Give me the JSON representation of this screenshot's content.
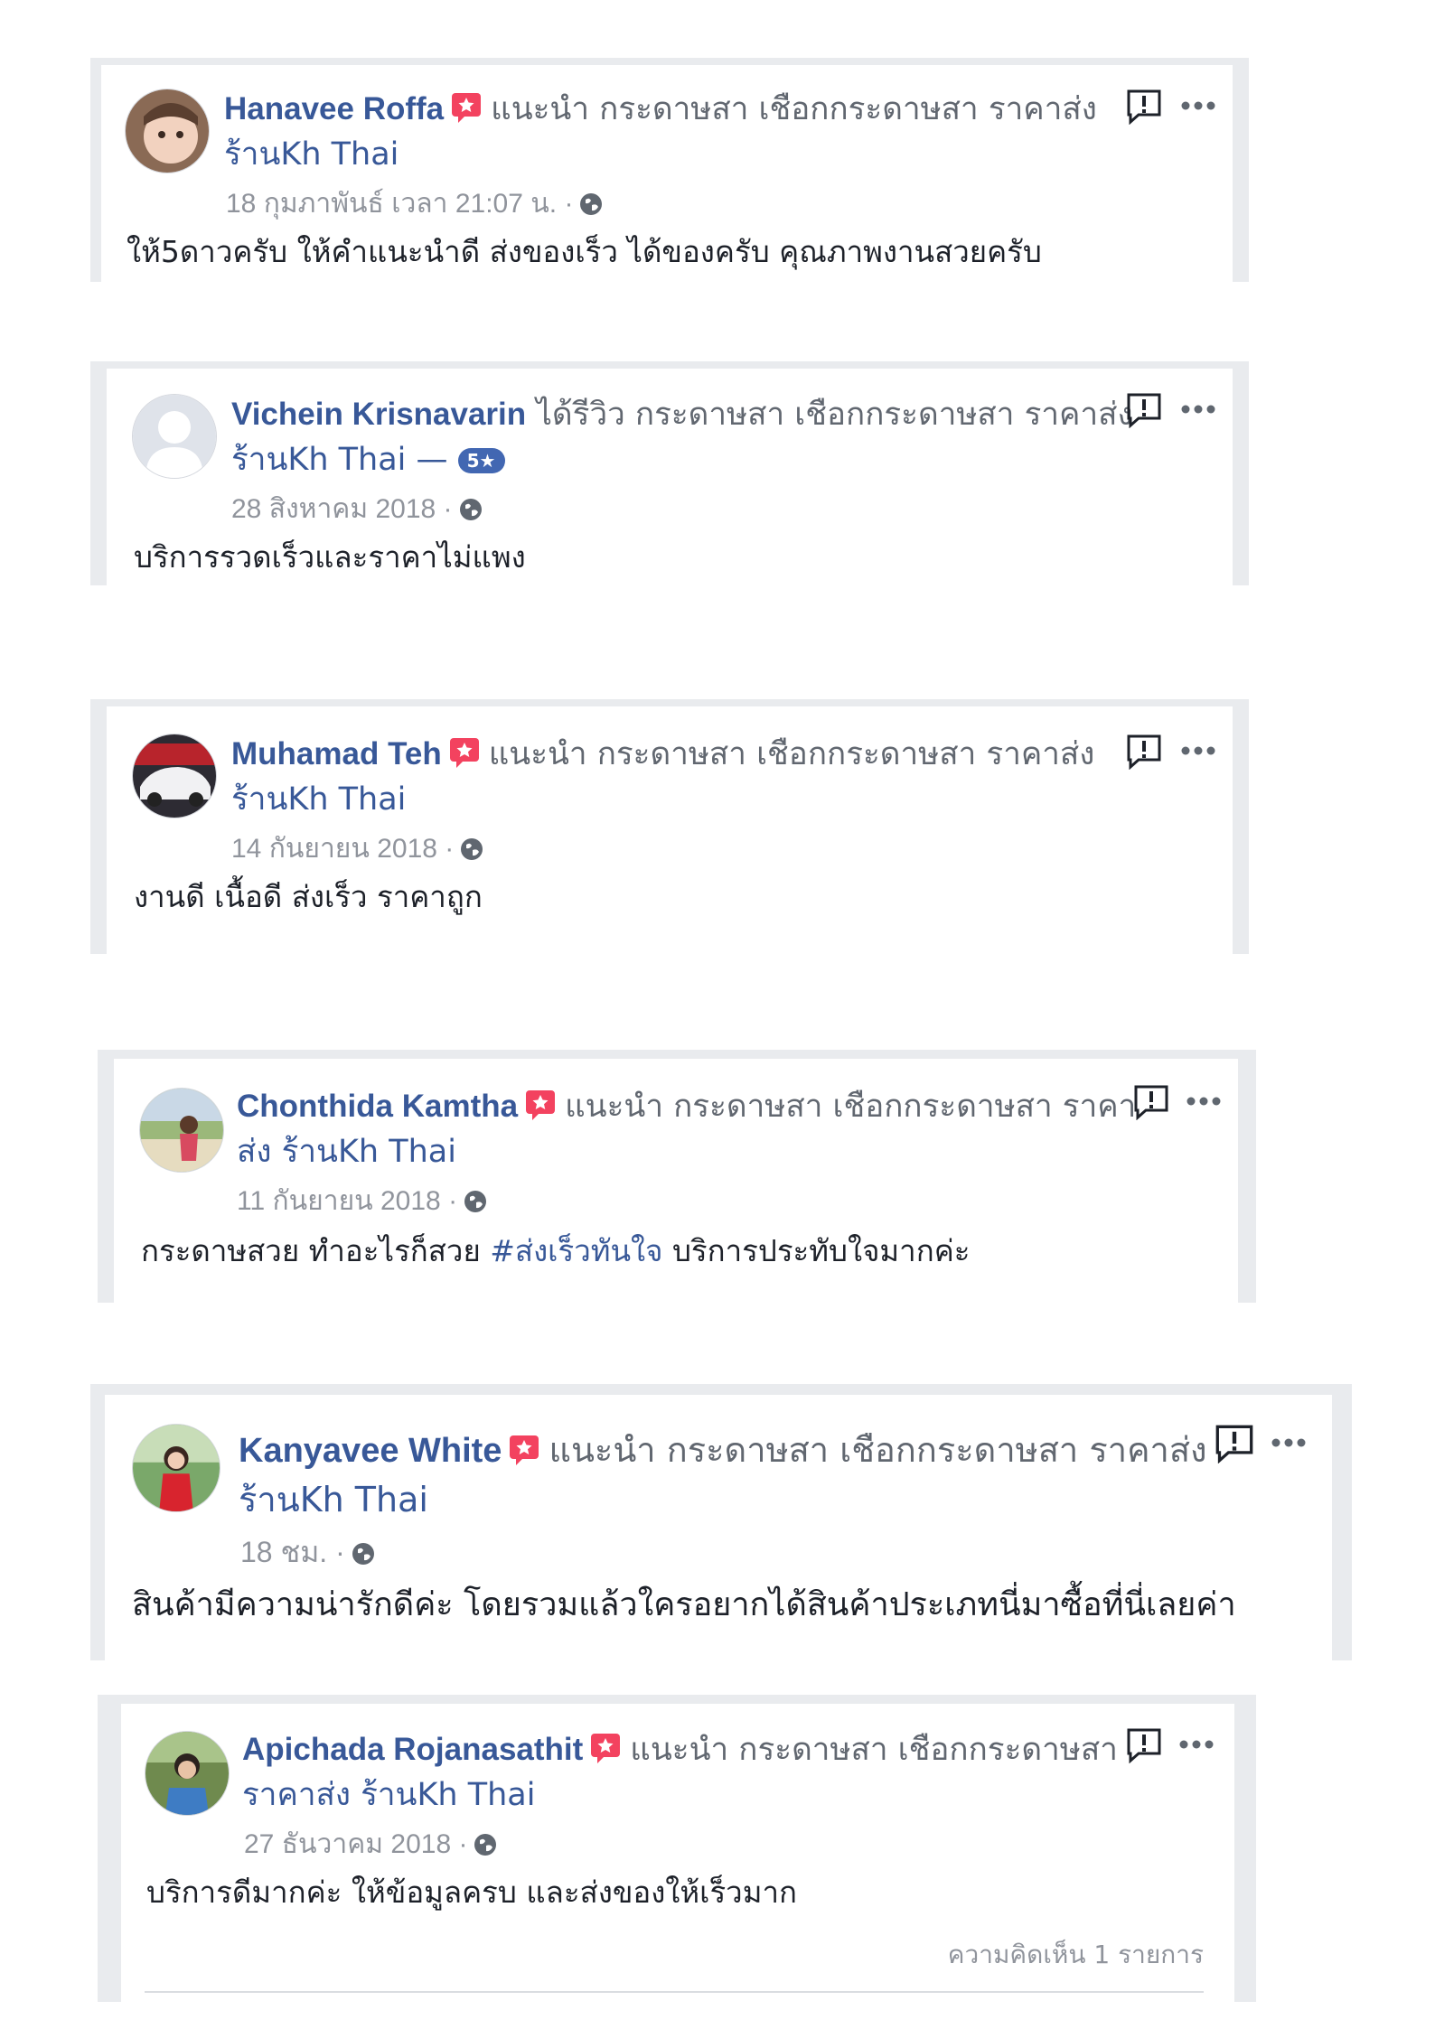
{
  "reviews": [
    {
      "name": "Hanavee Roffa",
      "action": "แนะนำ กระดาษสา เชือกกระดาษสา ราคาส่ง",
      "page": "ร้านKh Thai",
      "date": "18 กุมภาพันธ์ เวลา 21:07 น. ·",
      "text": "ให้5ดาวครับ ให้คำแนะนำดี ส่งของเร็ว ได้ของครับ คุณภาพงานสวยครับ"
    },
    {
      "name": "Vichein Krisnavarin",
      "action": "ได้รีวิว กระดาษสา เชือกกระดาษสา ราคาส่ง",
      "page": "ร้านKh Thai —",
      "rating_badge": "5★",
      "date": "28 สิงหาคม 2018 ·",
      "text": "บริการรวดเร็วและราคาไม่แพง"
    },
    {
      "name": "Muhamad Teh",
      "action": "แนะนำ กระดาษสา เชือกกระดาษสา ราคาส่ง",
      "page": "ร้านKh Thai",
      "date": "14 กันยายน 2018 ·",
      "text": "งานดี เนื้อดี ส่งเร็ว ราคาถูก"
    },
    {
      "name": "Chonthida Kamtha",
      "action": "แนะนำ กระดาษสา เชือกกระดาษสา ราคา",
      "page": "ส่ง ร้านKh Thai",
      "date": "11 กันยายน 2018 ·",
      "text_before": "กระดาษสวย ทำอะไรก็สวย ",
      "hashtag": "#ส่งเร็วทันใจ",
      "text_after": " บริการประทับใจมากค่ะ"
    },
    {
      "name": "Kanyavee White",
      "action": "แนะนำ กระดาษสา เชือกกระดาษสา ราคาส่ง",
      "page": "ร้านKh Thai",
      "date": "18 ชม. ·",
      "text": "สินค้ามีความน่ารักดีค่ะ โดยรวมแล้วใครอยากได้สินค้าประเภทนี่มาซื้อที่นี่เลยค่า"
    },
    {
      "name": "Apichada Rojanasathit",
      "action": "แนะนำ กระดาษสา เชือกกระดาษสา",
      "page": "ราคาส่ง ร้านKh Thai",
      "date": "27 ธันวาคม 2018 ·",
      "text": "บริการดีมากค่ะ ให้ข้อมูลครบ และส่งของให้เร็วมาก",
      "comments": "ความคิดเห็น 1 รายการ"
    }
  ],
  "colors": {
    "name_link": "#385898",
    "muted": "#90949c",
    "recommend_icon": "#f3425f",
    "frame": "#e9ebee"
  },
  "icons": {
    "recommend": "recommend-star-icon",
    "report": "report-icon",
    "more": "more-options-icon",
    "privacy": "globe-icon"
  }
}
